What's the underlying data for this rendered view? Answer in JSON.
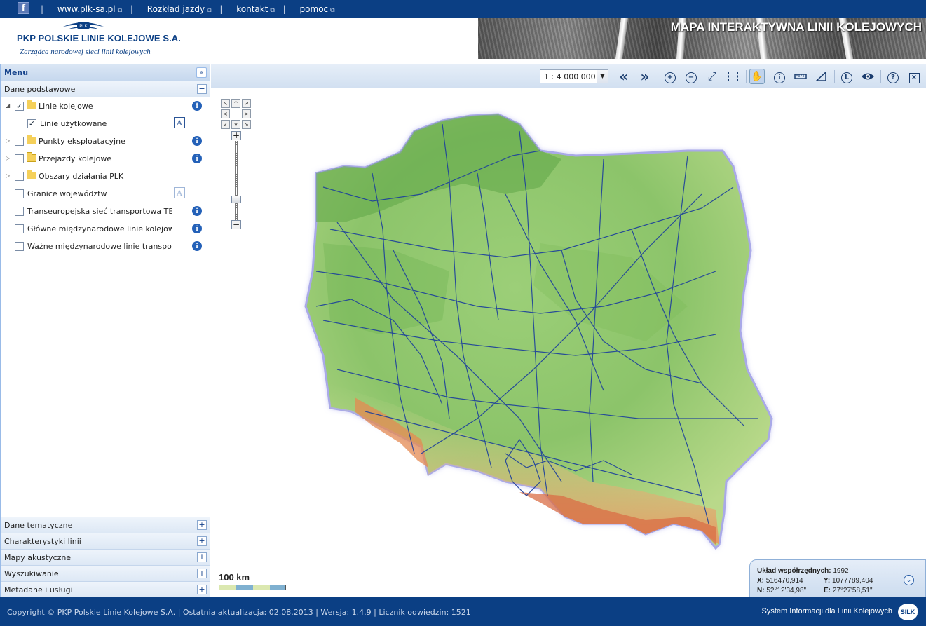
{
  "topbar": {
    "facebook_icon": "facebook-icon",
    "links": [
      {
        "label": "www.plk-sa.pl"
      },
      {
        "label": "Rozkład jazdy"
      },
      {
        "label": "kontakt"
      },
      {
        "label": "pomoc"
      }
    ],
    "separator": "|",
    "external_icon": "⧉"
  },
  "header": {
    "logo_badge": "PLK",
    "company": "PKP POLSKIE LINIE KOLEJOWE S.A.",
    "tagline": "Zarządca narodowej sieci linii kolejowych",
    "banner_title": "MAPA INTERAKTYWNA LINII KOLEJOWYCH"
  },
  "menu": {
    "title": "Menu",
    "collapse_icon": "«",
    "section_open": {
      "label": "Dane podstawowe",
      "toggle": "−"
    },
    "tree": [
      {
        "label": "Linie kolejowe",
        "checked": true,
        "expanded": true,
        "folder": true,
        "info": true
      },
      {
        "label": "Linie użytkowane",
        "checked": true,
        "child": true,
        "label_button": "A"
      },
      {
        "label": "Punkty eksploatacyjne",
        "checked": false,
        "folder": true,
        "info": true
      },
      {
        "label": "Przejazdy kolejowe",
        "checked": false,
        "folder": true,
        "info": true
      },
      {
        "label": "Obszary działania PLK",
        "checked": false,
        "folder": true
      },
      {
        "label": "Granice województw",
        "checked": false,
        "label_button": "A"
      },
      {
        "label": "Transeuropejska sieć transportowa TEN-T",
        "checked": false,
        "info": true
      },
      {
        "label": "Główne międzynarodowe linie kolejowe AGC",
        "checked": false,
        "info": true
      },
      {
        "label": "Ważne międzynarodowe linie transportu kombinowanego AGTC",
        "checked": false,
        "info": true
      }
    ],
    "info_glyph": "i",
    "sections_collapsed": [
      {
        "label": "Dane tematyczne",
        "toggle": "+"
      },
      {
        "label": "Charakterystyki linii",
        "toggle": "+"
      },
      {
        "label": "Mapy akustyczne",
        "toggle": "+"
      },
      {
        "label": "Wyszukiwanie",
        "toggle": "+"
      },
      {
        "label": "Metadane i usługi",
        "toggle": "+"
      }
    ]
  },
  "toolbar": {
    "scale_value": "1 : 4 000 000",
    "dropdown_glyph": "▼",
    "tools": [
      {
        "name": "back-icon",
        "glyph": "«"
      },
      {
        "name": "forward-icon",
        "glyph": "»"
      },
      {
        "name": "zoom-in-icon",
        "glyph": "+"
      },
      {
        "name": "zoom-out-icon",
        "glyph": "−"
      },
      {
        "name": "full-extent-icon",
        "glyph": "⤢"
      },
      {
        "name": "select-box-icon",
        "glyph": ""
      },
      {
        "name": "pan-hand-icon",
        "glyph": "✋"
      },
      {
        "name": "info-icon",
        "glyph": "i"
      },
      {
        "name": "measure-distance-icon",
        "glyph": "📏"
      },
      {
        "name": "measure-area-icon",
        "glyph": "◺"
      },
      {
        "name": "legend-icon",
        "glyph": "L"
      },
      {
        "name": "visibility-icon",
        "glyph": "◉"
      },
      {
        "name": "help-icon",
        "glyph": "?"
      },
      {
        "name": "close-icon",
        "glyph": "×"
      }
    ]
  },
  "mapnav": {
    "pan_glyphs": [
      "↖",
      "^",
      "↗",
      "<",
      ">",
      "↙",
      "v",
      "↘"
    ],
    "zoom_in": "+",
    "zoom_out": "−"
  },
  "scalebar": {
    "label": "100 km"
  },
  "coords": {
    "system_label": "Układ współrzędnych:",
    "system_value": "1992",
    "x_label": "X:",
    "x_value": "516470,914",
    "y_label": "Y:",
    "y_value": "1077789,404",
    "n_label": "N:",
    "n_value": "52°12'34,98\"",
    "e_label": "E:",
    "e_value": "27°27'58,51\"",
    "toggle_glyph": "⌄"
  },
  "footer": {
    "left": "Copyright © PKP Polskie Linie Kolejowe S.A. | Ostatnia aktualizacja: 02.08.2013 | Wersja: 1.4.9 | Licznik odwiedzin: 1521",
    "right": "System Informacji dla Linii Kolejowych",
    "logo": "SILK"
  },
  "colors": {
    "brand_blue": "#0b3f84",
    "panel_border": "#99bbe8",
    "land_green": "#8cc46a",
    "mountain_orange": "#e59a63",
    "rail_line": "#1c3f9c"
  }
}
